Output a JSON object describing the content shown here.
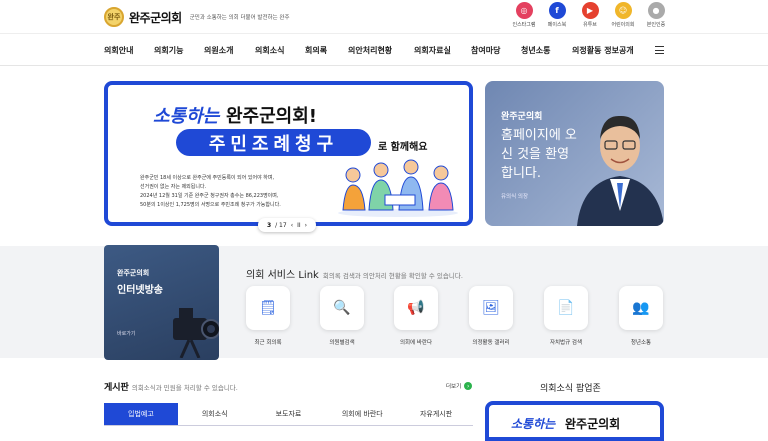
{
  "header": {
    "logo_mark": "완주",
    "site_name": "완주군의회",
    "slogan": "군민과 소통하는 의회 더불어 발전하는 완주",
    "sns": [
      {
        "label": "인스타그램",
        "icon": "instagram-icon",
        "glyph": "◎",
        "color": "#e4405f"
      },
      {
        "label": "페이스북",
        "icon": "facebook-icon",
        "glyph": "f",
        "color": "#1f49d6"
      },
      {
        "label": "유투브",
        "icon": "youtube-icon",
        "glyph": "▶",
        "color": "#e5412f"
      },
      {
        "label": "어린이의회",
        "icon": "kids-icon",
        "glyph": "☺",
        "color": "#f0b62a"
      },
      {
        "label": "본인인증",
        "icon": "user-icon",
        "glyph": "●",
        "color": "#aaaaaa"
      }
    ]
  },
  "nav": {
    "items": [
      "의회안내",
      "의회기능",
      "의원소개",
      "의회소식",
      "회의록",
      "의안처리현황",
      "의회자료실",
      "참여마당",
      "청년소통",
      "의정활동 정보공개"
    ]
  },
  "banner": {
    "headline_a": "소통하는",
    "headline_b": "완주군의회!",
    "pill": "주민조례청구",
    "with": "로 함께해요",
    "desc": [
      "완주군민 18세 이상으로 완주군에 주민등록이 되어 있어야 하며,",
      "선거권이 없는 자는 제외됩니다.",
      "2024년 12월 31일 기준 완주군 청구권자 총수는 86,223명이며,",
      "50분의 1이상인 1,725명의 서명으로 주민조례 청구가 가능합니다."
    ],
    "pager": {
      "current": "3",
      "total": "/ 17",
      "prev": "‹",
      "pause": "II",
      "next": "›"
    }
  },
  "mayor": {
    "org": "완주군의회",
    "greeting": "홈페이지에 오신 것을 환영합니다.",
    "name": "유의식 의장"
  },
  "live": {
    "org": "완주군의회",
    "title": "인터넷방송",
    "link": "바로가기"
  },
  "service": {
    "title": "의회 서비스 Link",
    "subtitle": "회의록 검색과 의안처리 현황을 확인할 수 있습니다.",
    "items": [
      {
        "label": "최근 회의록",
        "icon": "clipboard-clock-icon",
        "glyph": "🗒"
      },
      {
        "label": "의원별검색",
        "icon": "person-search-icon",
        "glyph": "🔍"
      },
      {
        "label": "의회에 바란다",
        "icon": "megaphone-icon",
        "glyph": "📢"
      },
      {
        "label": "의정활동 갤러리",
        "icon": "gallery-icon",
        "glyph": "🖼"
      },
      {
        "label": "자치법규 검색",
        "icon": "document-search-icon",
        "glyph": "📄"
      },
      {
        "label": "청년소통",
        "icon": "youth-icon",
        "glyph": "👥"
      }
    ]
  },
  "board": {
    "title": "게시판",
    "subtitle": "의회소식과 민원을 처리할 수 있습니다.",
    "more": "더보기",
    "tabs": [
      "입법예고",
      "의회소식",
      "보도자료",
      "의회에 바란다",
      "자유게시판"
    ],
    "active_tab": 0
  },
  "popup": {
    "title": "의회소식 팝업존",
    "text_a": "소통하는",
    "text_b": "완주군의회"
  }
}
